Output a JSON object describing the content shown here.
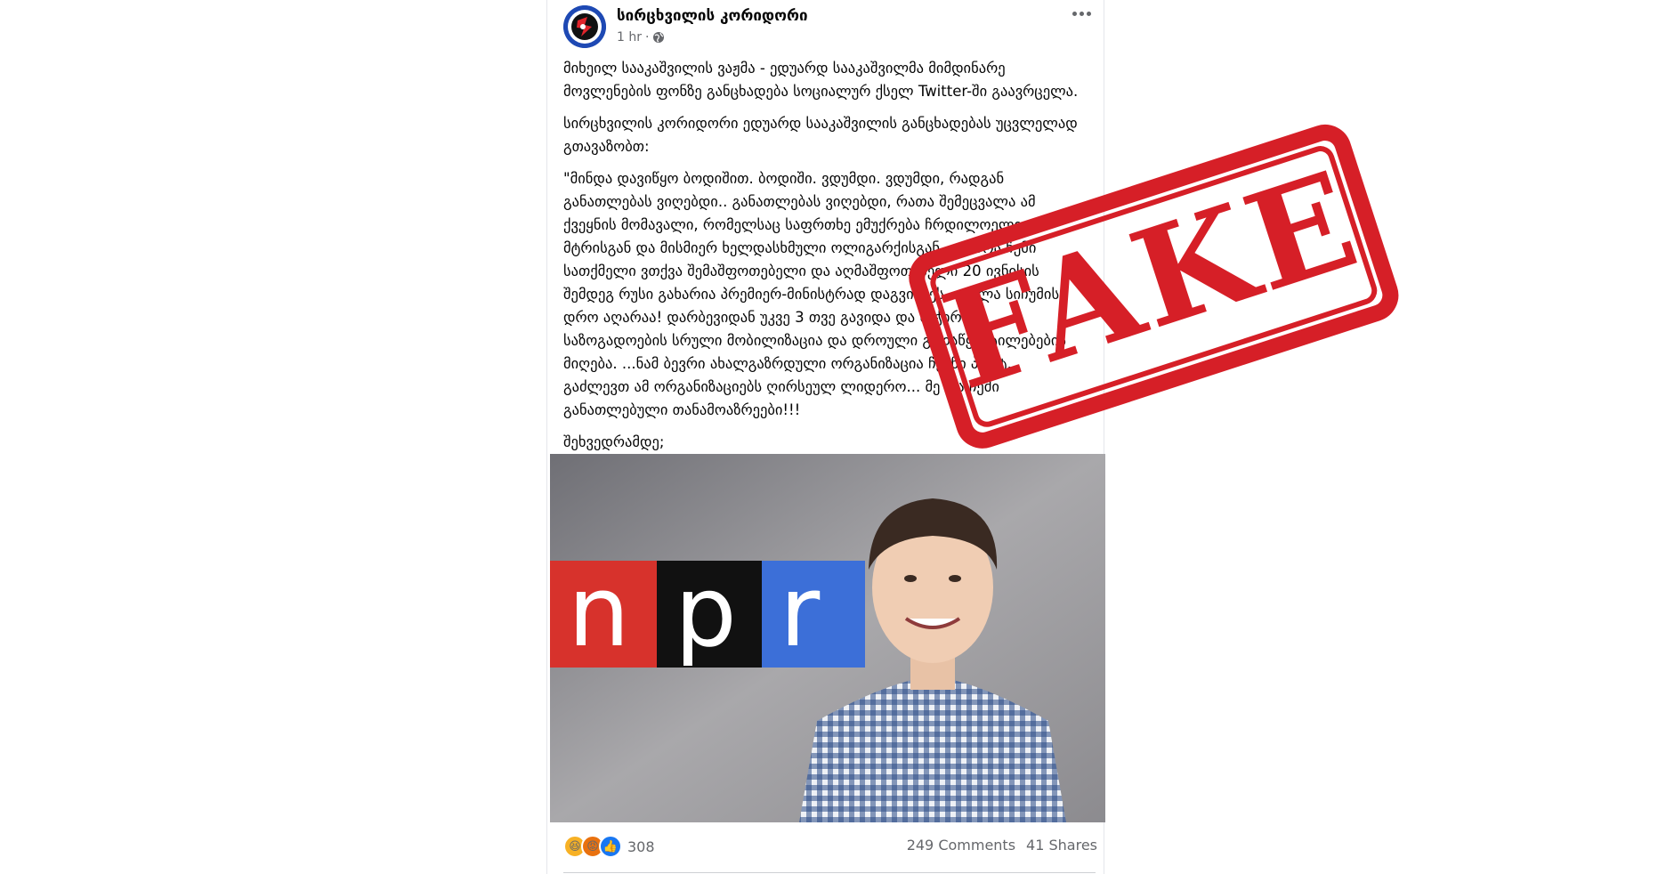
{
  "post": {
    "page_name": "სირცხვილის კორიდორი",
    "time": "1 hr",
    "time_separator": "·",
    "privacy_icon": "globe-icon",
    "more_icon": "more-options-icon",
    "paragraphs": [
      "მიხეილ სააკაშვილის ვაჟმა - ედუარდ სააკაშვილმა მიმდინარე მოვლენების ფონზე განცხადება სოციალურ ქსელ Twitter-ში გაავრცელა.",
      "სირცხვილის კორიდორი ედუარდ სააკაშვილის განცხადებას უცვლელად გთავაზობთ:",
      "\"მინდა დავიწყო ბოდიშით. ბოდიში. ვდუმდი. ვდუმდი, რადგან განათლებას ვიღებდი.. განათლებას ვიღებდი, რათა შემეცვალა ამ ქვეყნის მომავალი, რომელსაც საფრთხე ემუქრება ჩრდილოელი მტრისგან და მისმიერ ხელდასხმული ოლიგარქისგან... დროა ჩემი სათქმელი ვთქვა შემაშფოთებელი და აღმაშფოთებელი 20 ივნისის შემდეგ რუსი გახარია პრემიერ-მინისტრად დაგვისვეს... ახლა სიჩუმის დრო აღარაა! დარბევიდან უკვე 3 თვე გავიდა და საჭიროა საზოგადოების სრული მობილიზაცია და დროული გადაწყვეტილებების მიღება. ...ნამ ბევრი ახალგაზრდული ორგანიზაცია ჩვენი პარტ... გაძლევთ ამ ორგანიზაციებს ღირსეულ ლიდერო... მე და ჩემი განათლებული თანამოაზრეები!!!",
      "შეხვედრამდე;\nე.სააკაშვილი."
    ],
    "photo_sign_letters": [
      "n",
      "p",
      "r"
    ],
    "reactions": {
      "icons": [
        "haha-reaction-icon",
        "angry-reaction-icon",
        "like-reaction-icon"
      ],
      "count": "308"
    },
    "comments": "249 Comments",
    "shares": "41 Shares"
  },
  "stamp": {
    "text": "FAKE",
    "color": "#d61f27"
  },
  "colors": {
    "secondary_text": "#65676b",
    "like_blue": "#1877f2",
    "npr_red": "#d7322c",
    "npr_black": "#111111",
    "npr_blue": "#3c6fd8"
  }
}
